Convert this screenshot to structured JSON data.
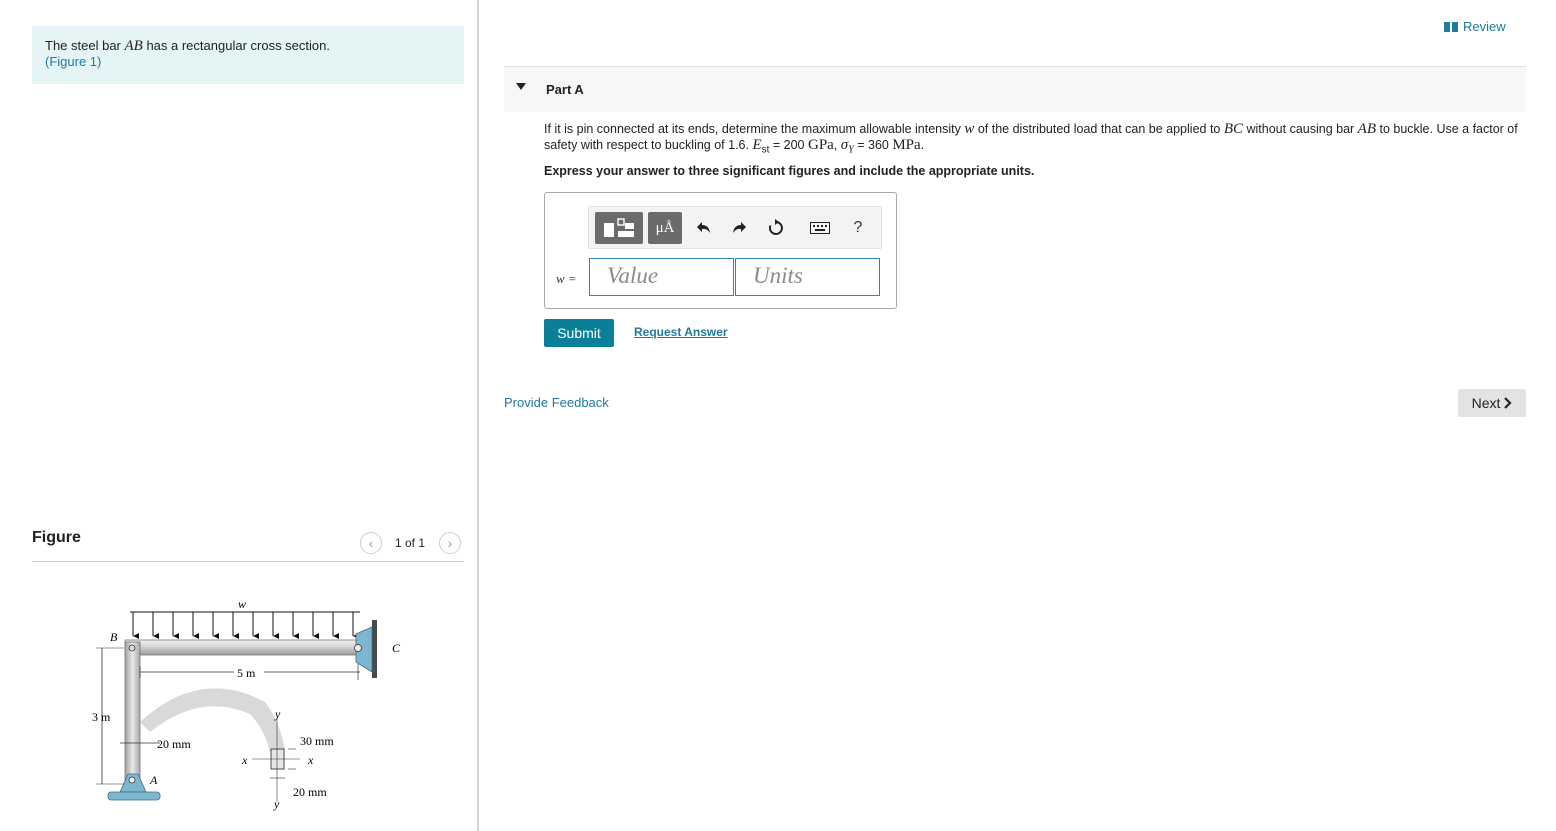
{
  "intro": {
    "text_before": "The steel bar ",
    "bar_name": "AB",
    "text_after": " has a rectangular cross section.",
    "figure_link": "(Figure 1)"
  },
  "figure": {
    "heading": "Figure",
    "counter": "1 of 1",
    "labels": {
      "load": "w",
      "point_b": "B",
      "point_c": "C",
      "point_a": "A",
      "span": "5 m",
      "height": "3 m",
      "width_small": "20 mm",
      "section_depth": "30 mm",
      "section_width": "20 mm",
      "axis_x": "x",
      "axis_y": "y"
    }
  },
  "review": {
    "label": "Review"
  },
  "part": {
    "title": "Part A",
    "question": {
      "t1": "If it is pin connected at its ends, determine the maximum allowable intensity ",
      "var_w": "w",
      "t2": " of the distributed load that can be applied to ",
      "bc": "BC",
      "t3": " without causing bar ",
      "ab": "AB",
      "t4": " to buckle. Use a factor of safety with respect to buckling of 1.6. ",
      "e_sym": "E",
      "e_sub": "st",
      "t5": " = 200 ",
      "gpa": "GPa",
      "t6": ", ",
      "sigma": "σ",
      "sigma_sub": "Y",
      "t7": " = 360 ",
      "mpa": "MPa",
      "t8": "."
    },
    "instructions": "Express your answer to three significant figures and include the appropriate units."
  },
  "answer": {
    "toolbar": {
      "units_label": "μÅ",
      "help_label": "?",
      "icons": [
        "templates-icon",
        "units-icon",
        "undo-icon",
        "redo-icon",
        "reset-icon",
        "keyboard-icon",
        "help-icon"
      ]
    },
    "variable_label": "w =",
    "value_placeholder": "Value",
    "units_placeholder": "Units"
  },
  "actions": {
    "submit": "Submit",
    "request_answer": "Request Answer",
    "provide_feedback": "Provide Feedback",
    "next": "Next"
  },
  "colors": {
    "link": "#217a9c",
    "submit_bg": "#0a7f98",
    "intro_bg": "#e5f4f5",
    "input_border": "#2f86b0"
  }
}
